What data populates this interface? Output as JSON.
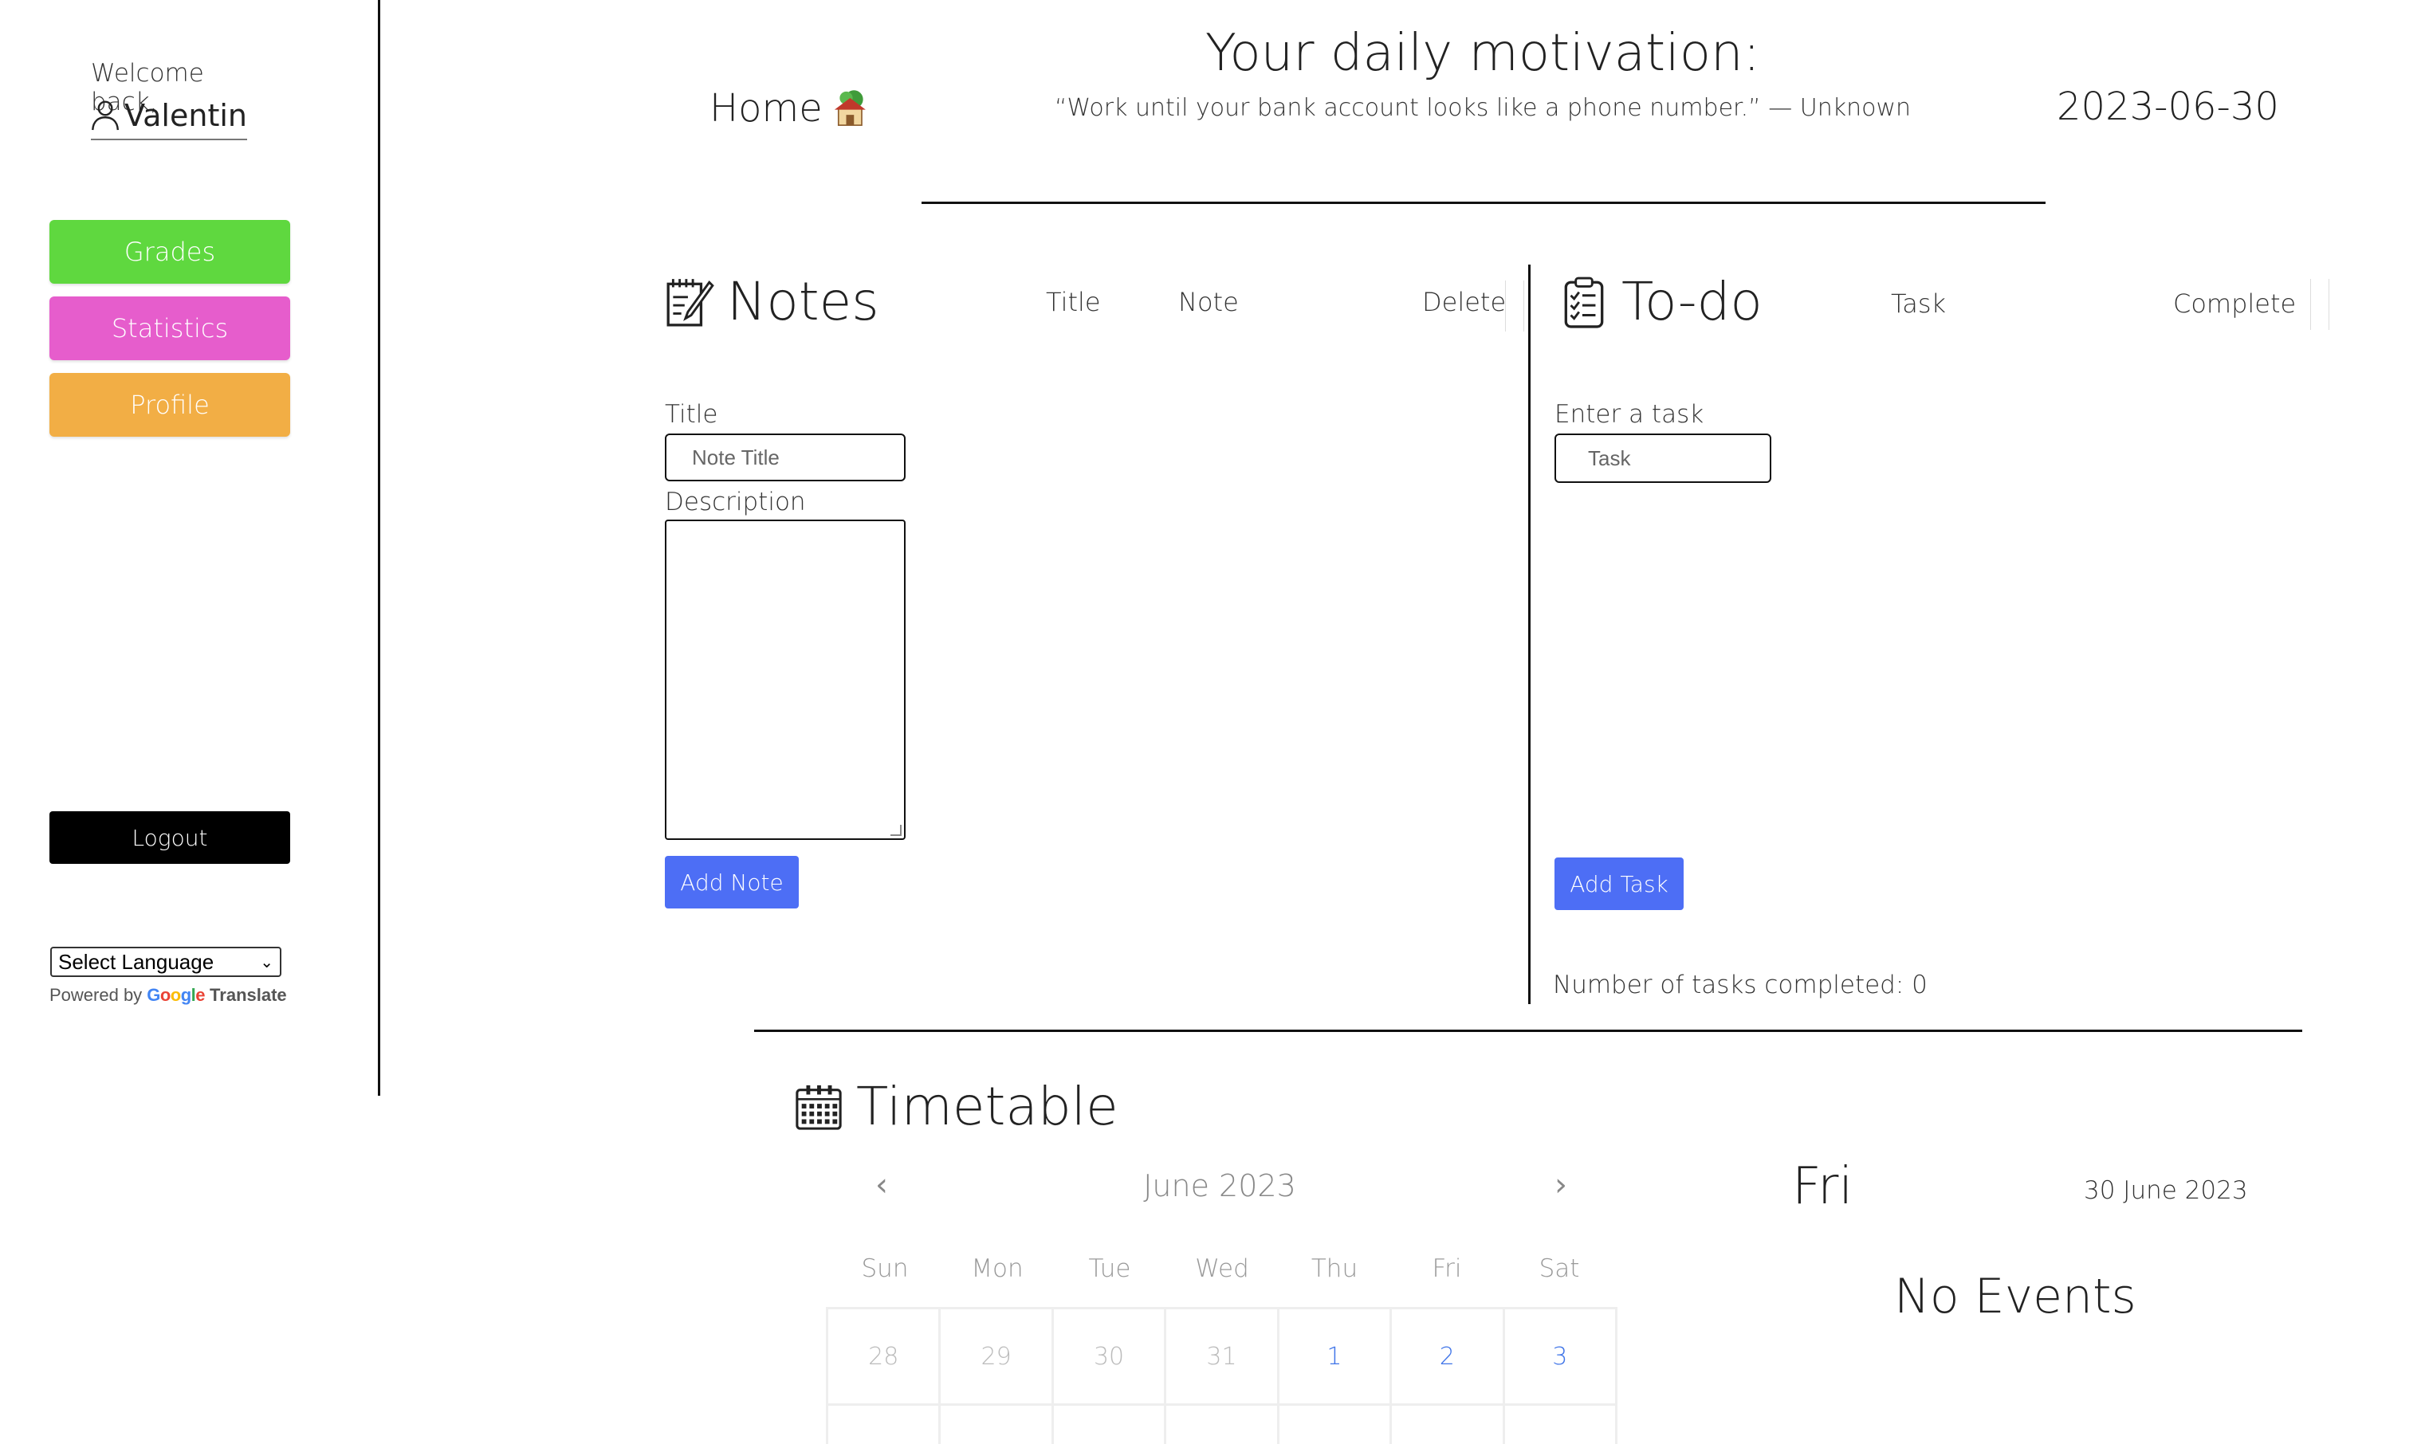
{
  "sidebar": {
    "welcome": "Welcome back,",
    "username": "Valentin",
    "nav": [
      {
        "label": "Grades",
        "color": "#5fd83f"
      },
      {
        "label": "Statistics",
        "color": "#e65dcc"
      },
      {
        "label": "Profile",
        "color": "#f2ae45"
      }
    ],
    "logout": "Logout",
    "language_select": "Select Language",
    "powered_by": "Powered by",
    "google": "Google",
    "translate": "Translate"
  },
  "header": {
    "home": "Home",
    "motivation_title": "Your daily motivation:",
    "quote": "“Work until your bank account looks like a phone number.” — Unknown",
    "date": "2023-06-30"
  },
  "notes": {
    "title": "Notes",
    "columns": [
      "Title",
      "Note",
      "Delete"
    ],
    "title_label": "Title",
    "title_placeholder": "Note Title",
    "description_label": "Description",
    "add_button": "Add Note"
  },
  "todo": {
    "title": "To-do",
    "columns": [
      "Task",
      "Complete"
    ],
    "task_label": "Enter a task",
    "task_placeholder": "Task",
    "add_button": "Add Task",
    "completed_count": "Number of tasks completed: 0"
  },
  "timetable": {
    "title": "Timetable",
    "month": "June 2023",
    "prev": "‹",
    "next": "›",
    "weekdays": [
      "Sun",
      "Mon",
      "Tue",
      "Wed",
      "Thu",
      "Fri",
      "Sat"
    ],
    "week1": [
      {
        "day": "28",
        "muted": true
      },
      {
        "day": "29",
        "muted": true
      },
      {
        "day": "30",
        "muted": true
      },
      {
        "day": "31",
        "muted": true
      },
      {
        "day": "1",
        "muted": false
      },
      {
        "day": "2",
        "muted": false
      },
      {
        "day": "3",
        "muted": false
      }
    ],
    "selected_day_name": "Fri",
    "selected_date": "30 June 2023",
    "no_events": "No Events"
  },
  "colors": {
    "accent_blue": "#4d6ef5",
    "calendar_active": "#3f74e8"
  }
}
